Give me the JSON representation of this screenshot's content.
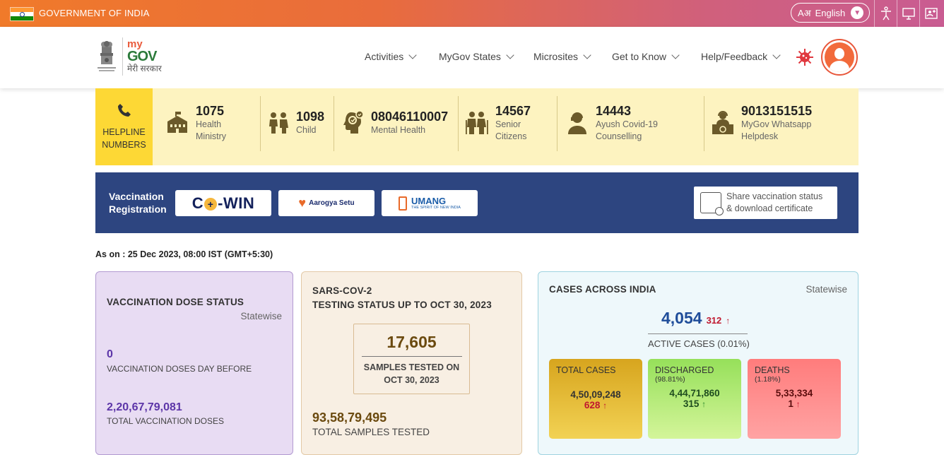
{
  "gov_bar": {
    "title": "GOVERNMENT OF INDIA",
    "language": "English",
    "language_prefix": "Aअ",
    "icons": [
      "accessibility-icon",
      "screen-reader-icon",
      "user-add-icon"
    ]
  },
  "header": {
    "logo_my": "my",
    "logo_gov": "GOV",
    "logo_hindi": "मेरी सरकार",
    "nav": [
      "Activities",
      "MyGov States",
      "Microsites",
      "Get to Know",
      "Help/Feedback"
    ]
  },
  "helpline": {
    "label_line1": "HELPLINE",
    "label_line2": "NUMBERS",
    "items": [
      {
        "number": "1075",
        "label1": "Health",
        "label2": "Ministry",
        "icon": "hospital-icon"
      },
      {
        "number": "1098",
        "label1": "Child",
        "label2": "",
        "icon": "children-icon"
      },
      {
        "number": "08046110007",
        "label1": "Mental Health",
        "label2": "",
        "icon": "mind-icon"
      },
      {
        "number": "14567",
        "label1": "Senior",
        "label2": "Citizens",
        "icon": "elderly-icon"
      },
      {
        "number": "14443",
        "label1": "Ayush Covid-19",
        "label2": "Counselling",
        "icon": "counsellor-icon"
      },
      {
        "number": "9013151515",
        "label1": "MyGov Whatsapp",
        "label2": "Helpdesk",
        "icon": "helpdesk-icon"
      }
    ]
  },
  "vaccination": {
    "title_line1": "Vaccination",
    "title_line2": "Registration",
    "cowin_pre": "C",
    "cowin_plus": "+",
    "cowin_post": "-WIN",
    "aarogya": "Aarogya Setu",
    "umang_title": "UMANG",
    "umang_sub": "THE SPIRIT OF NEW INDIA",
    "share_line1": "Share vaccination status",
    "share_line2": "& download certificate"
  },
  "as_on": "As on : 25 Dec 2023, 08:00 IST (GMT+5:30)",
  "vaccination_card": {
    "title": "VACCINATION DOSE STATUS",
    "statewise": "Statewise",
    "day_before_value": "0",
    "day_before_label": "VACCINATION DOSES DAY BEFORE",
    "total_value": "2,20,67,79,081",
    "total_label": "TOTAL VACCINATION DOSES"
  },
  "testing_card": {
    "title_line1": "SARS-COV-2",
    "title_line2": "TESTING STATUS UP TO OCT 30, 2023",
    "samples_value": "17,605",
    "samples_label1": "SAMPLES TESTED ON",
    "samples_label2": "OCT 30, 2023",
    "total_value": "93,58,79,495",
    "total_label": "TOTAL SAMPLES TESTED"
  },
  "cases_card": {
    "title": "CASES ACROSS INDIA",
    "statewise": "Statewise",
    "active_value": "4,054",
    "active_delta": "312",
    "active_label": "ACTIVE CASES (0.01%)",
    "total": {
      "label": "TOTAL CASES",
      "value": "4,50,09,248",
      "delta": "628"
    },
    "discharged": {
      "label": "DISCHARGED",
      "pct": "(98.81%)",
      "value": "4,44,71,860",
      "delta": "315"
    },
    "deaths": {
      "label": "DEATHS",
      "pct": "(1.18%)",
      "value": "5,33,334",
      "delta": "1"
    },
    "colors": {
      "total": "#e8b93a",
      "discharged": "#b9ec7e",
      "deaths": "#ff8a8a",
      "up_red": "#c0182f",
      "up_green": "#2d8a2d"
    }
  }
}
